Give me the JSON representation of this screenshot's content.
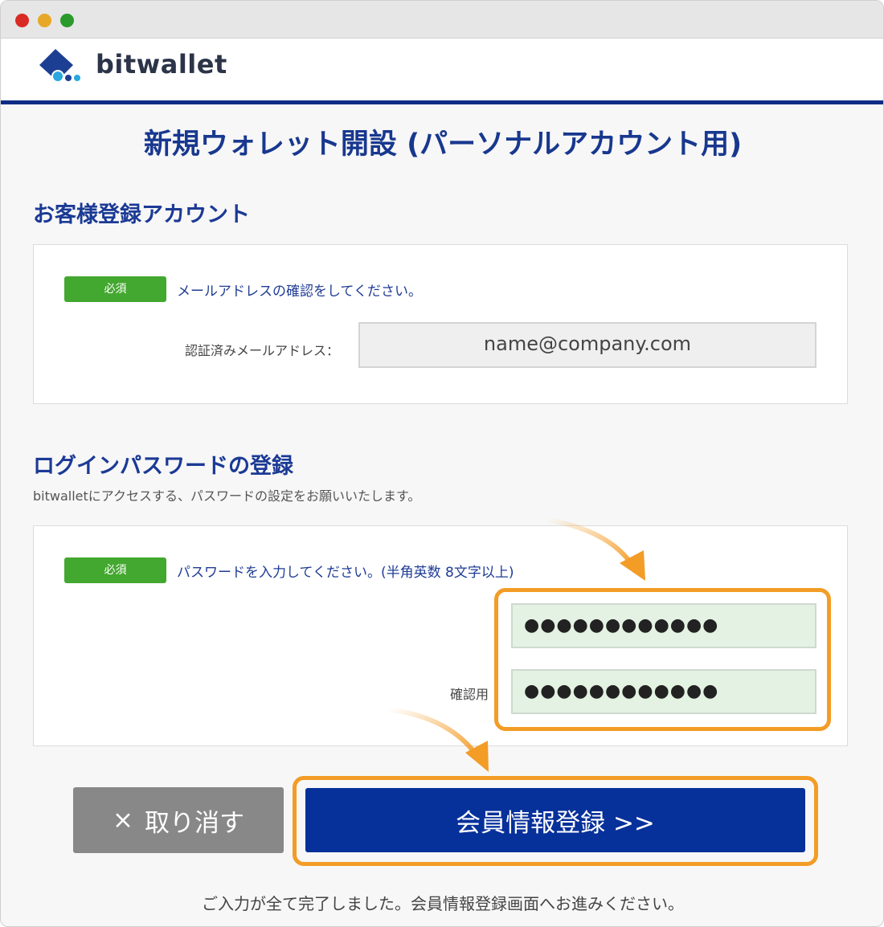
{
  "window": {
    "controls": [
      "close",
      "minimize",
      "zoom"
    ]
  },
  "header": {
    "brand": "bitwallet",
    "logo_icon": "bitwallet-logo-icon"
  },
  "page_title": "新規ウォレット開設 (パーソナルアカウント用)",
  "account_section": {
    "heading": "お客様登録アカウント",
    "required_badge": "必須",
    "instruction": "メールアドレスの確認をしてください。",
    "email_label": "認証済みメールアドレス：",
    "email_value": "name@company.com"
  },
  "password_section": {
    "heading": "ログインパスワードの登録",
    "description": "bitwalletにアクセスする、パスワードの設定をお願いいたします。",
    "required_badge": "必須",
    "instruction": "パスワードを入力してください。(半角英数 8文字以上)",
    "password_value": "●●●●●●●●●●●●",
    "confirm_label": "確認用",
    "confirm_value": "●●●●●●●●●●●●"
  },
  "actions": {
    "cancel_icon": "×",
    "cancel_label": "取り消す",
    "submit_label": "会員情報登録 >>"
  },
  "footer_note": "ご入力が全て完了しました。会員情報登録画面へお進みください。",
  "colors": {
    "brand_blue": "#06309a",
    "heading_blue": "#1b3a95",
    "required_green": "#43a82f",
    "highlight_orange": "#f39c26",
    "cancel_gray": "#888888",
    "input_green": "#e3f2e3"
  }
}
